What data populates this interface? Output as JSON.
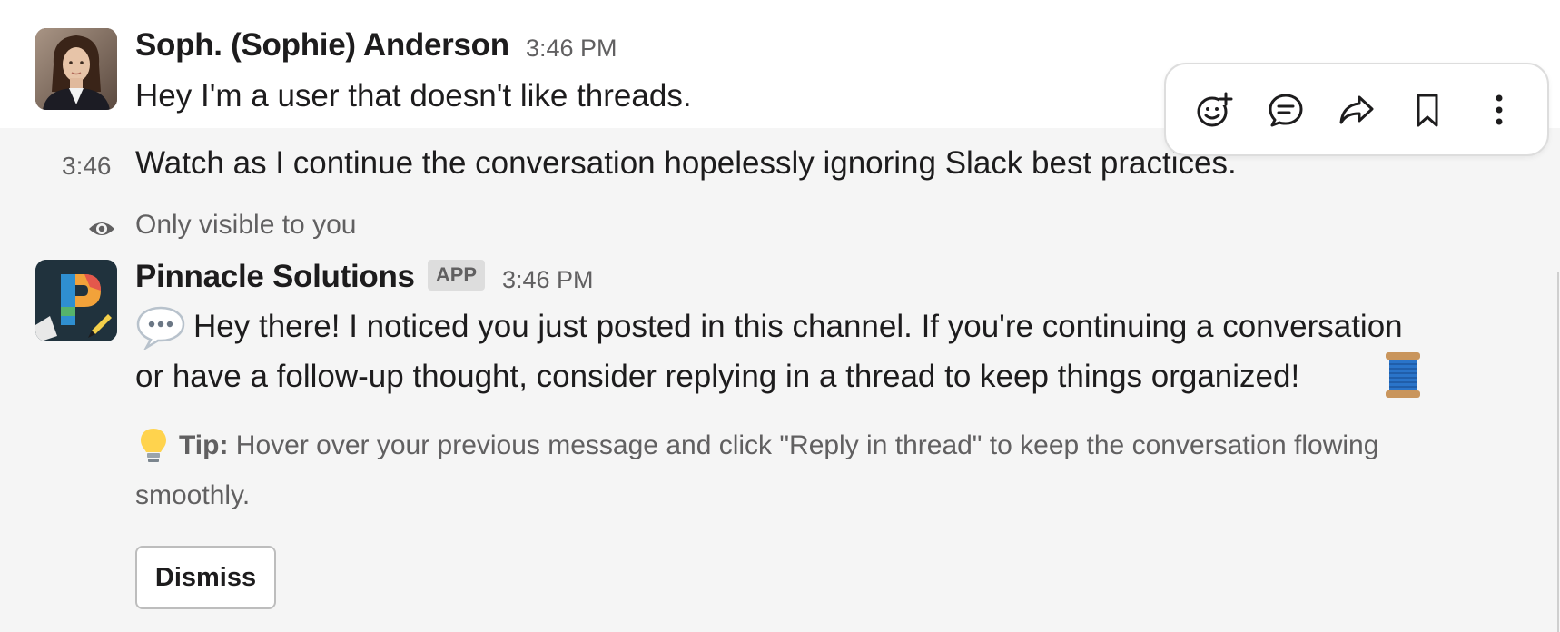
{
  "messages": {
    "first": {
      "sender": "Soph. (Sophie) Anderson",
      "time": "3:46 PM",
      "text": "Hey I'm a user that doesn't like threads."
    },
    "second": {
      "time": "3:46",
      "text": "Watch as I continue the conversation hopelessly ignoring Slack best practices."
    },
    "app": {
      "visibility_note": "Only visible to you",
      "sender": "Pinnacle Solutions",
      "badge": "APP",
      "time": "3:46 PM",
      "body_line1": "Hey there! I noticed you just posted in this channel. If you're continuing a conversation",
      "body_line2": "or have a follow-up thought, consider replying in a thread to keep things organized!",
      "tip_label": "Tip:",
      "tip_line1": "Hover over your previous message and click \"Reply in thread\" to keep the conversation flowing",
      "tip_line2": "smoothly.",
      "dismiss_label": "Dismiss"
    }
  },
  "toolbar": {
    "icons": [
      "add-reaction-icon",
      "reply-in-thread-icon",
      "share-icon",
      "save-bookmark-icon",
      "more-actions-icon"
    ]
  },
  "icons": {
    "eye": "eye-icon",
    "speech_bubble": "speech-bubble-emoji",
    "spool": "spool-of-thread-emoji",
    "bulb": "light-bulb-emoji"
  },
  "colors": {
    "text_primary": "#1d1c1d",
    "text_secondary": "#616061",
    "hover_background": "#f5f5f5",
    "badge_background": "#dddddd"
  }
}
